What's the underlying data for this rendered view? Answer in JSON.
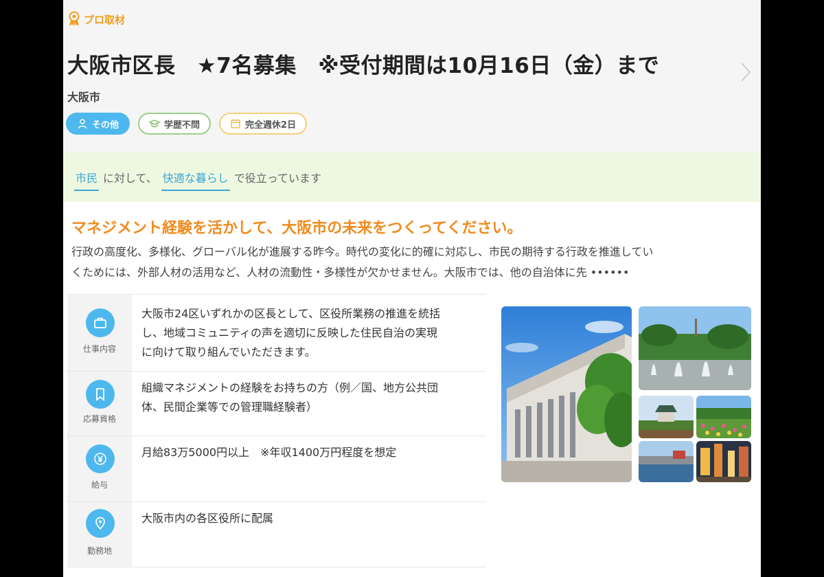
{
  "header": {
    "pro_badge": "プロ取材",
    "title": "大阪市区長　★7名募集　※受付期間は10月16日（金）まで",
    "employer": "大阪市",
    "tags": [
      {
        "label": "その他",
        "icon": "person-icon",
        "color": "#4db8ee"
      },
      {
        "label": "学歴不問",
        "icon": "graduation-cap-icon",
        "color": "#9ad08a"
      },
      {
        "label": "完全週休2日",
        "icon": "calendar-icon",
        "color": "#f3cf7a"
      }
    ]
  },
  "contribution": {
    "target": "市民",
    "text1": "に対して、",
    "value": "快適な暮らし",
    "text2": "で役立っています"
  },
  "catch": {
    "headline": "マネジメント経験を活かして、大阪市の未来をつくってください。",
    "line1": "行政の高度化、多様化、グローバル化が進展する昨今。時代の変化に的確に対応し、市民の期待する行政を推進してい",
    "line2": "くためには、外部人材の活用など、人材の流動性・多様性が欠かせません。大阪市では、他の自治体に先 ••••••"
  },
  "details": [
    {
      "label": "仕事内容",
      "icon": "briefcase-icon",
      "lines": [
        "大阪市24区いずれかの区長として、区役所業務の推進を統括",
        "し、地域コミュニティの声を適切に反映した住民自治の実現",
        "に向けて取り組んでいただきます。"
      ]
    },
    {
      "label": "応募資格",
      "icon": "bookmark-icon",
      "lines": [
        "組織マネジメントの経験をお持ちの方（例／国、地方公共団",
        "体、民間企業等での管理職経験者）"
      ]
    },
    {
      "label": "給与",
      "icon": "yen-icon",
      "lines": [
        "月給83万5000円以上　※年収1400万円程度を想定"
      ]
    },
    {
      "label": "勤務地",
      "icon": "location-pin-icon",
      "lines": [
        "大阪市内の各区役所に配属"
      ]
    }
  ],
  "colors": {
    "accent": "#4db8ee",
    "orange": "#f08b1e",
    "green_band": "#eef8e1"
  }
}
